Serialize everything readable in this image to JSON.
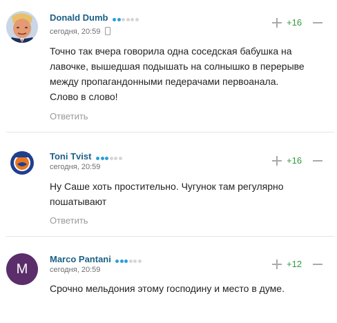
{
  "comments": [
    {
      "author": "Donald Dumb",
      "rating_dots": 6,
      "rating_filled": 2,
      "time": "сегодня, 20:59",
      "device_icon": "mobile-phone-icon",
      "score": "+16",
      "lines": [
        "Точно так вчера говорила одна соседская бабушка на",
        "лавочке, вышедшая подышать на солнышко в перерыве",
        "между пропагандонными педерачами первоанала.",
        "Слово в слово!"
      ],
      "reply": "Ответить"
    },
    {
      "author": "Toni Tvist",
      "rating_dots": 6,
      "rating_filled": 3,
      "time": "сегодня, 20:59",
      "score": "+16",
      "lines": [
        "Ну Саше хоть простительно. Чугунок там регулярно",
        "пошатывают"
      ],
      "reply": "Ответить",
      "avatar_logo_text": "EDMONTON OILERS"
    },
    {
      "author": "Marco Pantani",
      "rating_dots": 6,
      "rating_filled": 3,
      "time": "сегодня, 20:59",
      "score": "+12",
      "lines": [
        "Срочно мельдония этому господину и место в думе."
      ],
      "avatar_letter": "M",
      "avatar_color": "#5b2d6a"
    }
  ],
  "colors": {
    "author": "#1a5f86",
    "score": "#2f9b3c",
    "dot_active": "#2a9fd8"
  }
}
